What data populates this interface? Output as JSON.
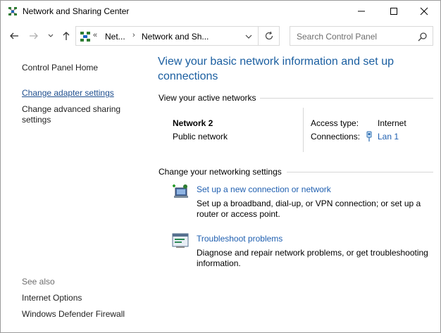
{
  "window": {
    "title": "Network and Sharing Center"
  },
  "nav": {
    "breadcrumb_overflow": "«",
    "crumbs": [
      "Net...",
      "Network and Sh..."
    ],
    "search_placeholder": "Search Control Panel"
  },
  "left": {
    "home": "Control Panel Home",
    "adapter": "Change adapter settings",
    "advanced_line1": "Change advanced sharing",
    "advanced_line2": "settings",
    "see_also": "See also",
    "internet_options": "Internet Options",
    "firewall": "Windows Defender Firewall"
  },
  "main": {
    "heading": "View your basic network information and set up connections",
    "active_title": "View your active networks",
    "network_name": "Network 2",
    "network_type": "Public network",
    "access_label": "Access type:",
    "access_value": "Internet",
    "connections_label": "Connections:",
    "connections_value": "Lan 1",
    "change_title": "Change your networking settings",
    "setup_link": "Set up a new connection or network",
    "setup_desc": "Set up a broadband, dial-up, or VPN connection; or set up a router or access point.",
    "trouble_link": "Troubleshoot problems",
    "trouble_desc": "Diagnose and repair network problems, or get troubleshooting information."
  },
  "icons": {
    "app": "network-icon",
    "minimize": "minimize-icon",
    "maximize": "maximize-icon",
    "close": "close-icon",
    "back": "back-arrow-icon",
    "forward": "forward-arrow-icon",
    "recent": "chevron-down-icon",
    "up": "up-arrow-icon",
    "refresh": "refresh-icon",
    "search": "search-icon",
    "connection": "ethernet-icon",
    "setup": "new-connection-icon",
    "troubleshoot": "troubleshoot-icon"
  },
  "colors": {
    "heading": "#1a5ea0",
    "link": "#1f5fb0"
  }
}
